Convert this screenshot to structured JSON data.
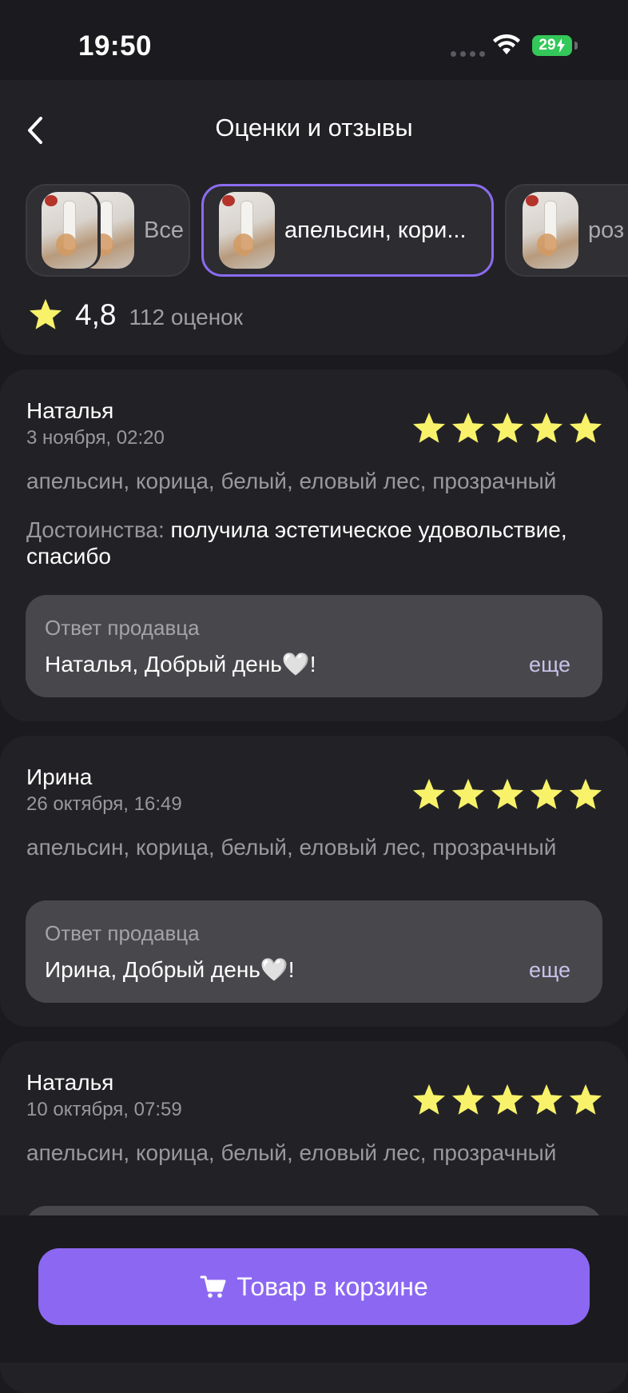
{
  "status": {
    "time": "19:50",
    "battery": "29"
  },
  "header": {
    "title": "Оценки и отзывы"
  },
  "filters": [
    {
      "label": "Все",
      "selected": false
    },
    {
      "label": "апельсин, кори...",
      "selected": true
    },
    {
      "label": "роз",
      "selected": false
    }
  ],
  "summary": {
    "rating": "4,8",
    "count": "112 оценок"
  },
  "reviews": [
    {
      "name": "Наталья",
      "date": "3 ноября, 02:20",
      "stars": 5,
      "variant": "апельсин, корица, белый, еловый лес, прозрачный",
      "text_prefix": "Достоинства:",
      "text_body": " получила эстетическое удовольствие, спасибо",
      "reply_label": "Ответ продавца",
      "reply_text": "Наталья, Добрый день🤍!",
      "reply_more": "еще"
    },
    {
      "name": "Ирина",
      "date": "26 октября, 16:49",
      "stars": 5,
      "variant": "апельсин, корица, белый, еловый лес, прозрачный",
      "reply_label": "Ответ продавца",
      "reply_text": "Ирина, Добрый день🤍!",
      "reply_more": "еще"
    },
    {
      "name": "Наталья",
      "date": "10 октября, 07:59",
      "stars": 5,
      "variant": "апельсин, корица, белый, еловый лес, прозрачный"
    }
  ],
  "cart_button": {
    "label": "Товар в корзине",
    "icon": "cart-icon"
  },
  "colors": {
    "accent": "#8c68f2",
    "star": "#f7f26a",
    "background": "#1b1b1f",
    "card": "#222226"
  }
}
